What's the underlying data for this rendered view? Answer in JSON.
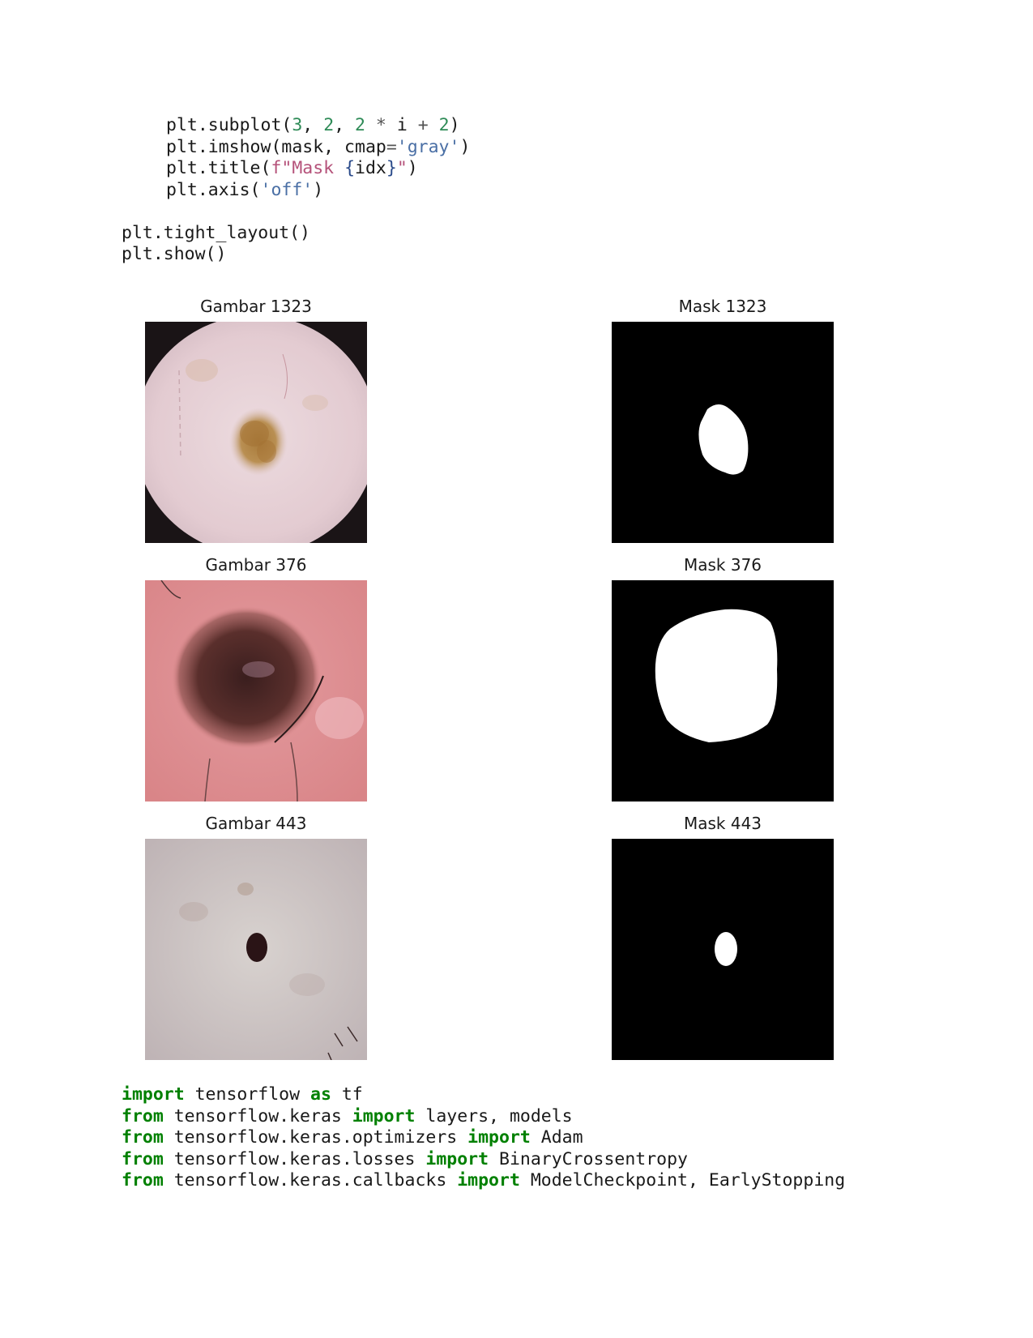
{
  "code_top": {
    "line1": {
      "a": "plt.subplot(",
      "n1": "3",
      "c1": ", ",
      "n2": "2",
      "c2": ", ",
      "n3": "2",
      "op1": " * ",
      "i": "i",
      "op2": " + ",
      "n4": "2",
      "end": ")"
    },
    "line2": {
      "a": "plt.imshow(mask, cmap",
      "eq": "=",
      "s": "'gray'",
      "end": ")"
    },
    "line3": {
      "a": "plt.title(",
      "f": "f\"Mask ",
      "b1": "{",
      "v": "idx",
      "b2": "}",
      "q": "\"",
      "end": ")"
    },
    "line4": {
      "a": "plt.axis(",
      "s": "'off'",
      "end": ")"
    },
    "line5": "plt.tight_layout()",
    "line6": "plt.show()"
  },
  "figure": {
    "panels": [
      {
        "title": "Gambar 1323",
        "kind": "image"
      },
      {
        "title": "Mask 1323",
        "kind": "mask"
      },
      {
        "title": "Gambar 376",
        "kind": "image"
      },
      {
        "title": "Mask 376",
        "kind": "mask"
      },
      {
        "title": "Gambar 443",
        "kind": "image"
      },
      {
        "title": "Mask 443",
        "kind": "mask"
      }
    ]
  },
  "code_bottom": {
    "l1": {
      "k1": "import",
      "t1": " tensorflow ",
      "k2": "as",
      "t2": " tf"
    },
    "l2": {
      "k1": "from",
      "t1": " tensorflow.keras ",
      "k2": "import",
      "t2": " layers, models"
    },
    "l3": {
      "k1": "from",
      "t1": " tensorflow.keras.optimizers ",
      "k2": "import",
      "t2": " Adam"
    },
    "l4": {
      "k1": "from",
      "t1": " tensorflow.keras.losses ",
      "k2": "import",
      "t2": " BinaryCrossentropy"
    },
    "l5": {
      "k1": "from",
      "t1": " tensorflow.keras.callbacks ",
      "k2": "import",
      "t2": " ModelCheckpoint, EarlyStopping"
    }
  },
  "colors": {
    "keyword": "#008000",
    "number": "#2e8b57",
    "string": "#4a6fa5",
    "fstring": "#b5527a",
    "mask_bg": "#000000",
    "mask_fg": "#ffffff"
  }
}
